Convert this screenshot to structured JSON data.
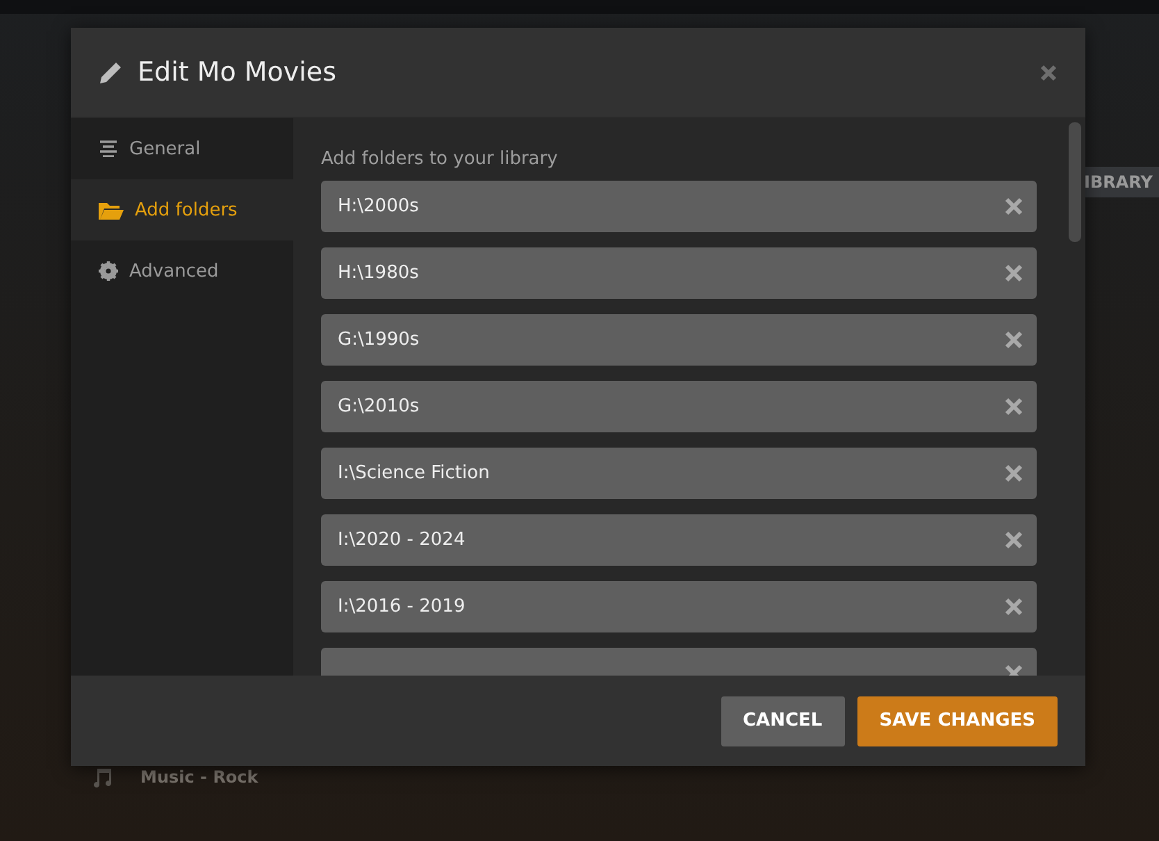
{
  "background": {
    "badge": "IBRARY",
    "list_item": "Music - Rock"
  },
  "dialog": {
    "title": "Edit Mo Movies",
    "sidebar": [
      {
        "label": "General",
        "kind": "general",
        "selected": false
      },
      {
        "label": "Add folders",
        "kind": "folders",
        "selected": true
      },
      {
        "label": "Advanced",
        "kind": "advanced",
        "selected": false
      }
    ],
    "section_label": "Add folders to your library",
    "folders": [
      {
        "kind": "full",
        "path": "H:\\2000s"
      },
      {
        "kind": "full",
        "path": "H:\\1980s"
      },
      {
        "kind": "full",
        "path": "G:\\1990s"
      },
      {
        "kind": "full",
        "path": "G:\\2010s"
      },
      {
        "kind": "full",
        "path": "I:\\Science Fiction"
      },
      {
        "kind": "full",
        "path": "I:\\2020 - 2024"
      },
      {
        "kind": "full",
        "path": "I:\\2016 - 2019"
      },
      {
        "kind": "cut"
      }
    ],
    "buttons": [
      {
        "label": "CANCEL",
        "kind": "secondary"
      },
      {
        "label": "SAVE CHANGES",
        "kind": "primary"
      }
    ]
  }
}
